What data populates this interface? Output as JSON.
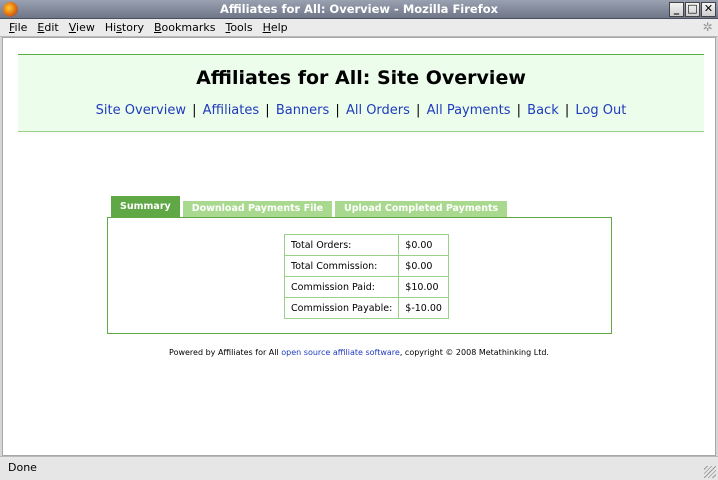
{
  "window": {
    "title": "Affiliates for All: Overview - Mozilla Firefox",
    "buttons": {
      "minimize": "_",
      "maximize": "□",
      "close": "✕"
    }
  },
  "menubar": {
    "items": [
      {
        "label": "File",
        "key": "F"
      },
      {
        "label": "Edit",
        "key": "E"
      },
      {
        "label": "View",
        "key": "V"
      },
      {
        "label": "History",
        "key": "s"
      },
      {
        "label": "Bookmarks",
        "key": "B"
      },
      {
        "label": "Tools",
        "key": "T"
      },
      {
        "label": "Help",
        "key": "H"
      }
    ]
  },
  "page": {
    "title": "Affiliates for All: Site Overview",
    "nav": [
      "Site Overview",
      "Affiliates",
      "Banners",
      "All Orders",
      "All Payments",
      "Back",
      "Log Out"
    ],
    "nav_separator": "|",
    "tabs": [
      {
        "label": "Summary",
        "active": true
      },
      {
        "label": "Download Payments File",
        "active": false
      },
      {
        "label": "Upload Completed Payments",
        "active": false
      }
    ],
    "summary": [
      {
        "label": "Total Orders:",
        "value": "$0.00"
      },
      {
        "label": "Total Commission:",
        "value": "$0.00"
      },
      {
        "label": "Commission Paid:",
        "value": "$10.00"
      },
      {
        "label": "Commission Payable:",
        "value": "$-10.00"
      }
    ],
    "footer": {
      "prefix": "Powered by Affiliates for All ",
      "link": "open source affiliate software",
      "suffix": ", copyright © 2008 Metathinking Ltd."
    }
  },
  "statusbar": {
    "text": "Done"
  },
  "colors": {
    "accent_green": "#5fa845",
    "tab_inactive": "#a9d98e",
    "header_bg": "#ecfdec",
    "link_blue": "#1f3bbd"
  }
}
